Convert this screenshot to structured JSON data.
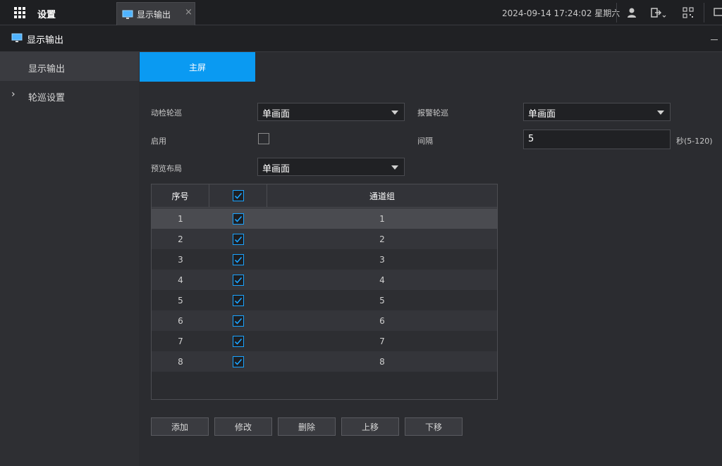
{
  "topbar": {
    "apps_title": "设置",
    "tab_label": "显示输出",
    "tab_close": "×",
    "datetime": "2024-09-14 17:24:02 星期六",
    "icons": [
      "user-icon",
      "logout-icon",
      "qrcode-icon",
      "monitor-icon"
    ]
  },
  "header": {
    "title": "显示输出"
  },
  "sidebar": {
    "items": [
      {
        "label": "显示输出",
        "selected": true
      },
      {
        "label": "轮巡设置",
        "chevron": "›",
        "selected": false
      }
    ]
  },
  "main": {
    "tab": "主屏",
    "motion_label": "动检轮巡",
    "motion_value": "单画面",
    "alarm_label": "报警轮巡",
    "alarm_value": "单画面",
    "enable_label": "启用",
    "enable_checked": false,
    "interval_label": "间隔",
    "interval_value": "5",
    "interval_unit": "秒(5-120)",
    "layout_label": "预览布局",
    "layout_value": "单画面"
  },
  "table": {
    "headers": [
      "序号",
      "",
      "通道组"
    ],
    "header_checked": true,
    "rows": [
      {
        "index": "1",
        "checked": true,
        "group": "1",
        "selected": true
      },
      {
        "index": "2",
        "checked": true,
        "group": "2"
      },
      {
        "index": "3",
        "checked": true,
        "group": "3"
      },
      {
        "index": "4",
        "checked": true,
        "group": "4"
      },
      {
        "index": "5",
        "checked": true,
        "group": "5"
      },
      {
        "index": "6",
        "checked": true,
        "group": "6"
      },
      {
        "index": "7",
        "checked": true,
        "group": "7"
      },
      {
        "index": "8",
        "checked": true,
        "group": "8"
      }
    ]
  },
  "buttons": {
    "add": "添加",
    "edit": "修改",
    "delete": "删除",
    "up": "上移",
    "down": "下移"
  },
  "colors": {
    "accent": "#0a9af2",
    "check": "#1aa3ff",
    "background": "#2b2c30"
  }
}
